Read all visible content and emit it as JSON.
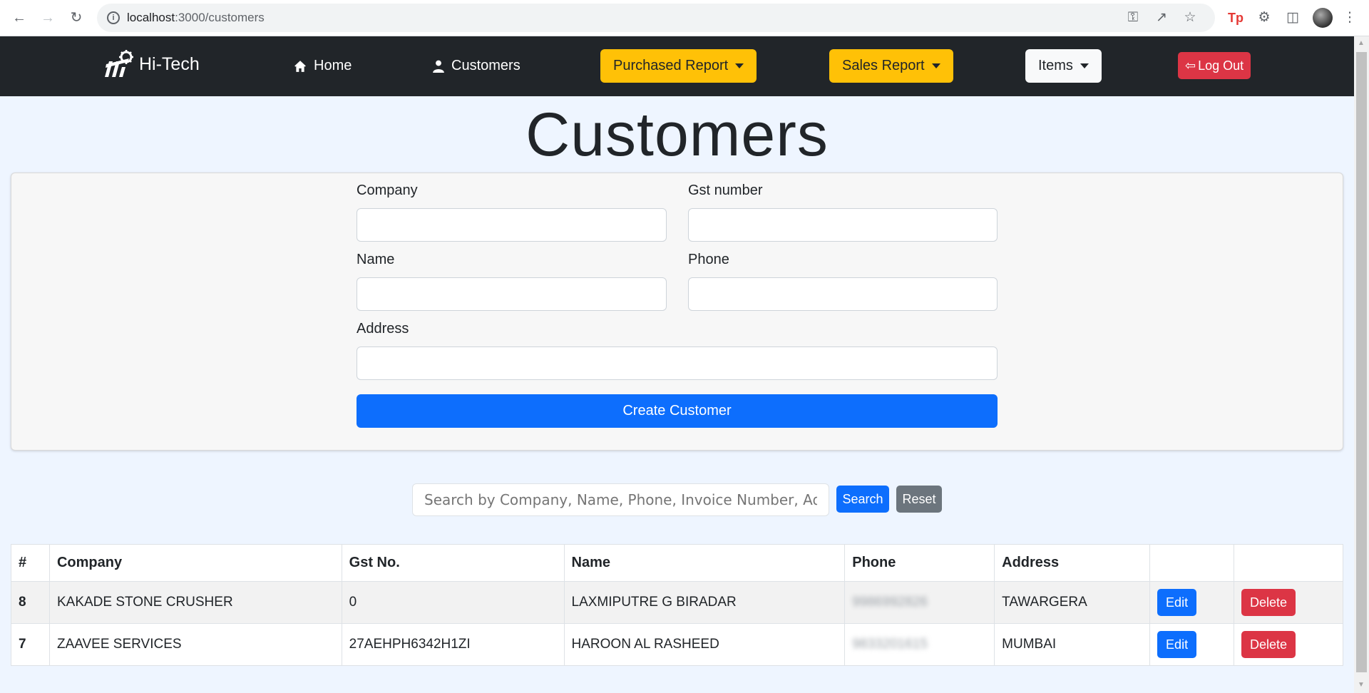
{
  "browser": {
    "url_host": "localhost",
    "url_path": ":3000/customers"
  },
  "navbar": {
    "brand": "Hi-Tech",
    "home": "Home",
    "customers": "Customers",
    "purchased_report": "Purchased Report",
    "sales_report": "Sales Report",
    "items": "Items",
    "logout": "Log Out"
  },
  "page": {
    "title": "Customers"
  },
  "form": {
    "company_label": "Company",
    "gst_label": "Gst number",
    "name_label": "Name",
    "phone_label": "Phone",
    "address_label": "Address",
    "company_value": "",
    "gst_value": "",
    "name_value": "",
    "phone_value": "",
    "address_value": "",
    "submit_label": "Create Customer"
  },
  "search": {
    "placeholder": "Search by Company, Name, Phone, Invoice Number, Address",
    "search_label": "Search",
    "reset_label": "Reset"
  },
  "table": {
    "headers": [
      "#",
      "Company",
      "Gst No.",
      "Name",
      "Phone",
      "Address",
      "",
      ""
    ],
    "rows": [
      {
        "id": "8",
        "company": "KAKADE STONE CRUSHER",
        "gst": "0",
        "name": "LAXMIPUTRE G BIRADAR",
        "phone": "9986992826",
        "address": "TAWARGERA",
        "edit": "Edit",
        "delete": "Delete"
      },
      {
        "id": "7",
        "company": "ZAAVEE SERVICES",
        "gst": "27AEHPH6342H1ZI",
        "name": "HAROON AL RASHEED",
        "phone": "9833201615",
        "address": "MUMBAI",
        "edit": "Edit",
        "delete": "Delete"
      }
    ]
  },
  "colors": {
    "primary": "#0d6efd",
    "warning": "#ffc107",
    "danger": "#dc3545",
    "secondary": "#6c757d",
    "navbar": "#212529",
    "page_bg": "#eef5ff"
  }
}
